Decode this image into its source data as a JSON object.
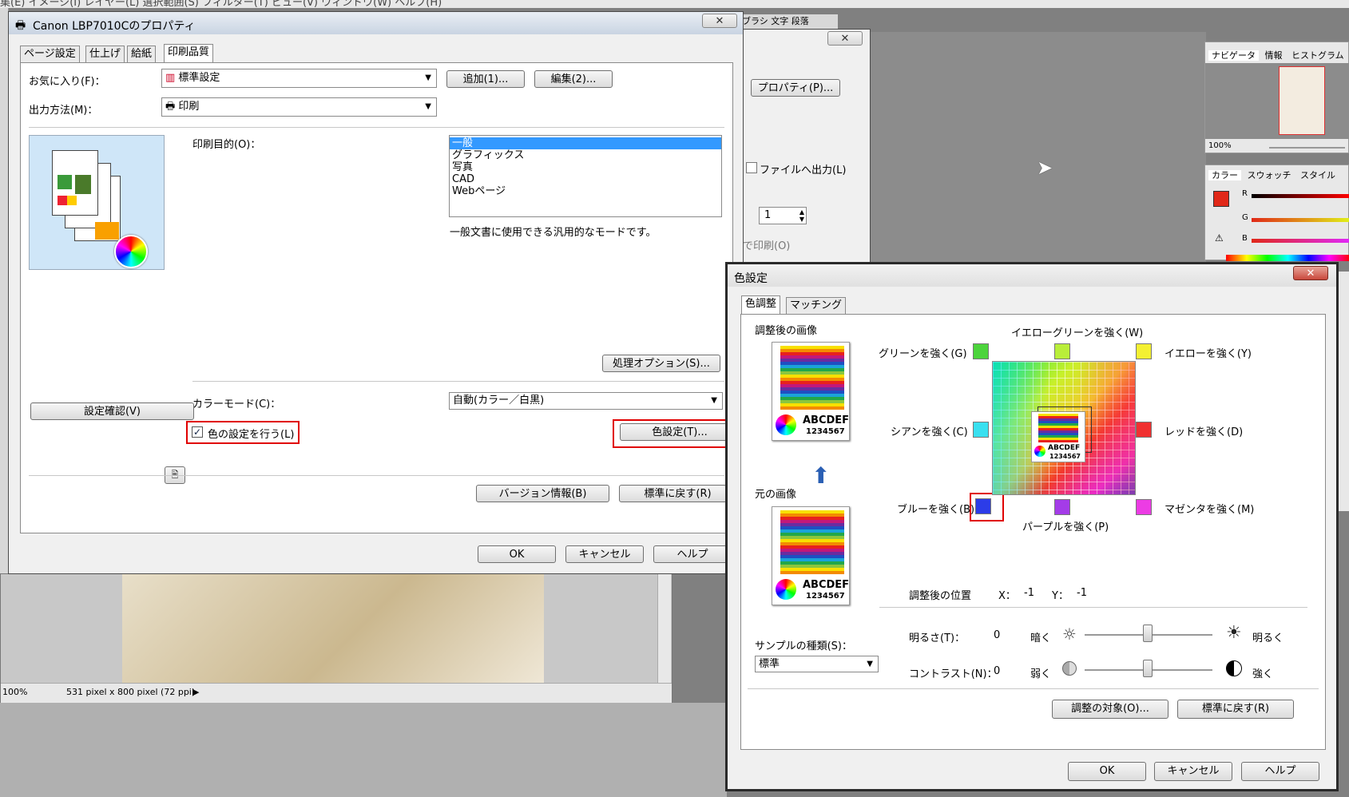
{
  "bg_app": {
    "menu_fragment": "集(E)  イメージ(I)  レイヤー(L)  選択範囲(S)  フィルター(T)  ビュー(V)  ウィンドウ(W)  ヘルプ(H)",
    "side_tabs": "ブラシ  文字  段落",
    "print_dialog": {
      "properties_btn": "プロパティ(P)...",
      "file_output": "ファイルへ出力(L)",
      "copies": "1",
      "collate_print": "で印刷(O)"
    },
    "status": {
      "zoom": "100%",
      "size": "531 pixel x 800 pixel (72 ppi)"
    }
  },
  "navigator": {
    "tabs": [
      "ナビゲータ",
      "情報",
      "ヒストグラム"
    ],
    "zoom": "100%",
    "color_tabs": [
      "カラー",
      "スウォッチ",
      "スタイル"
    ],
    "rgb_labels": [
      "R",
      "G",
      "B"
    ]
  },
  "canon": {
    "title": "Canon LBP7010Cのプロパティ",
    "close": "✕",
    "tabs": [
      "ページ設定",
      "仕上げ",
      "給紙",
      "印刷品質"
    ],
    "favorites_label": "お気に入り(F)：",
    "favorites_value": "標準設定",
    "add_btn": "追加(1)...",
    "edit_btn": "編集(2)...",
    "output_label": "出力方法(M)：",
    "output_value": "印刷",
    "purpose_label": "印刷目的(O)：",
    "purpose_list": [
      "一般",
      "グラフィックス",
      "写真",
      "CAD",
      "Webページ"
    ],
    "purpose_desc": "一般文書に使用できる汎用的なモードです。",
    "processing_btn": "処理オプション(S)...",
    "colormode_label": "カラーモード(C)：",
    "colormode_value": "自動(カラー／白黒)",
    "confirm_btn": "設定確認(V)",
    "color_check_label": "色の設定を行う(L)",
    "color_settings_btn": "色設定(T)...",
    "version_btn": "バージョン情報(B)",
    "reset_btn": "標準に戻す(R)",
    "ok": "OK",
    "cancel": "キャンセル",
    "help": "ヘルプ"
  },
  "color_dialog": {
    "title": "色設定",
    "close": "✕",
    "tabs": [
      "色調整",
      "マッチング"
    ],
    "adjusted_label": "調整後の画像",
    "original_label": "元の画像",
    "sample_text_1": "ABCDEF",
    "sample_text_2": "1234567",
    "directions": {
      "yellowgreen": "イエローグリーンを強く(W)",
      "green": "グリーンを強く(G)",
      "yellow": "イエローを強く(Y)",
      "cyan": "シアンを強く(C)",
      "red": "レッドを強く(D)",
      "blue": "ブルーを強く(B)",
      "magenta": "マゼンタを強く(M)",
      "purple": "パープルを強く(P)"
    },
    "position_label": "調整後の位置",
    "x_label": "X：",
    "x_value": "-1",
    "y_label": "Y：",
    "y_value": "-1",
    "brightness_label": "明るさ(T)：",
    "brightness_value": "0",
    "dark": "暗く",
    "bright": "明るく",
    "contrast_label": "コントラスト(N)：",
    "contrast_value": "0",
    "weak": "弱く",
    "strong": "強く",
    "sample_type_label": "サンプルの種類(S)：",
    "sample_type_value": "標準",
    "target_btn": "調整の対象(O)...",
    "reset_btn": "標準に戻す(R)",
    "ok": "OK",
    "cancel": "キャンセル",
    "help": "ヘルプ",
    "colors": {
      "green": "#4cd43c",
      "yellowgreen": "#b9ee3a",
      "yellow": "#f4f032",
      "cyan": "#39e0f0",
      "red": "#f03030",
      "blue": "#2c3ce8",
      "magenta": "#ec3ce4",
      "purple": "#a43ce8"
    }
  }
}
